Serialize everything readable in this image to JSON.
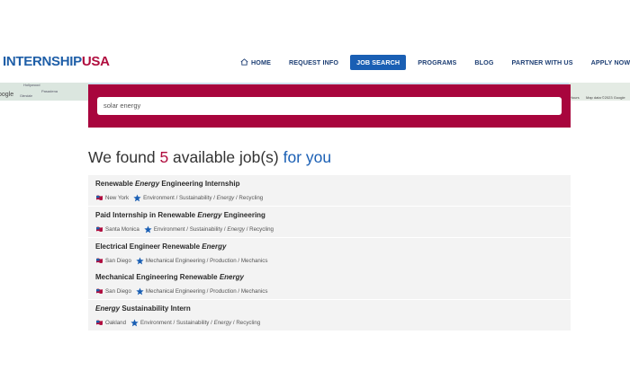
{
  "brand": {
    "part1": "INTERNSHIP",
    "part2": "USA"
  },
  "nav": [
    {
      "label": "HOME",
      "icon": "home-icon"
    },
    {
      "label": "REQUEST INFO"
    },
    {
      "label": "JOB SEARCH",
      "active": true
    },
    {
      "label": "PROGRAMS"
    },
    {
      "label": "BLOG"
    },
    {
      "label": "PARTNER WITH US"
    },
    {
      "label": "APPLY NOW & REG"
    }
  ],
  "map": {
    "logo_text": "oogle",
    "labels": [
      "Hollywood",
      "Pasadena",
      "Glendale"
    ],
    "hours_text": "Hours",
    "data_text": "Map data ©2023 Google"
  },
  "search": {
    "value": "solar energy"
  },
  "results": {
    "prefix": "We found ",
    "count": "5",
    "middle": " available job(s) ",
    "suffix": "for you"
  },
  "jobs": [
    {
      "title_pre": "Renewable ",
      "title_em": "Energy",
      "title_post": " Engineering Internship",
      "location": "New York",
      "cat_pre": "Environment / Sustainability / ",
      "cat_em": "Energy",
      "cat_post": " / Recycling"
    },
    {
      "title_pre": "Paid Internship in Renewable ",
      "title_em": "Energy",
      "title_post": " Engineering",
      "location": "Santa Monica",
      "cat_pre": "Environment / Sustainability / ",
      "cat_em": "Energy",
      "cat_post": " / Recycling"
    },
    {
      "title_pre": "Electrical Engineer Renewable ",
      "title_em": "Energy",
      "title_post": "",
      "location": "San Diego",
      "cat_pre": "Mechanical Engineering / Production / Mechanics",
      "cat_em": "",
      "cat_post": ""
    },
    {
      "title_pre": "Mechanical Engineering Renewable ",
      "title_em": "Energy",
      "title_post": "",
      "location": "San Diego",
      "cat_pre": "Mechanical Engineering / Production / Mechanics",
      "cat_em": "",
      "cat_post": ""
    },
    {
      "title_pre": "",
      "title_em": "Energy",
      "title_post": " Sustainability Intern",
      "location": "Oakland",
      "cat_pre": "Environment / Sustainability / ",
      "cat_em": "Energy",
      "cat_post": " / Recycling"
    }
  ],
  "colors": {
    "brand_blue": "#1f5fa8",
    "brand_red": "#b00d3e",
    "banner": "#a8053d",
    "active_nav": "#1a5fb4"
  }
}
